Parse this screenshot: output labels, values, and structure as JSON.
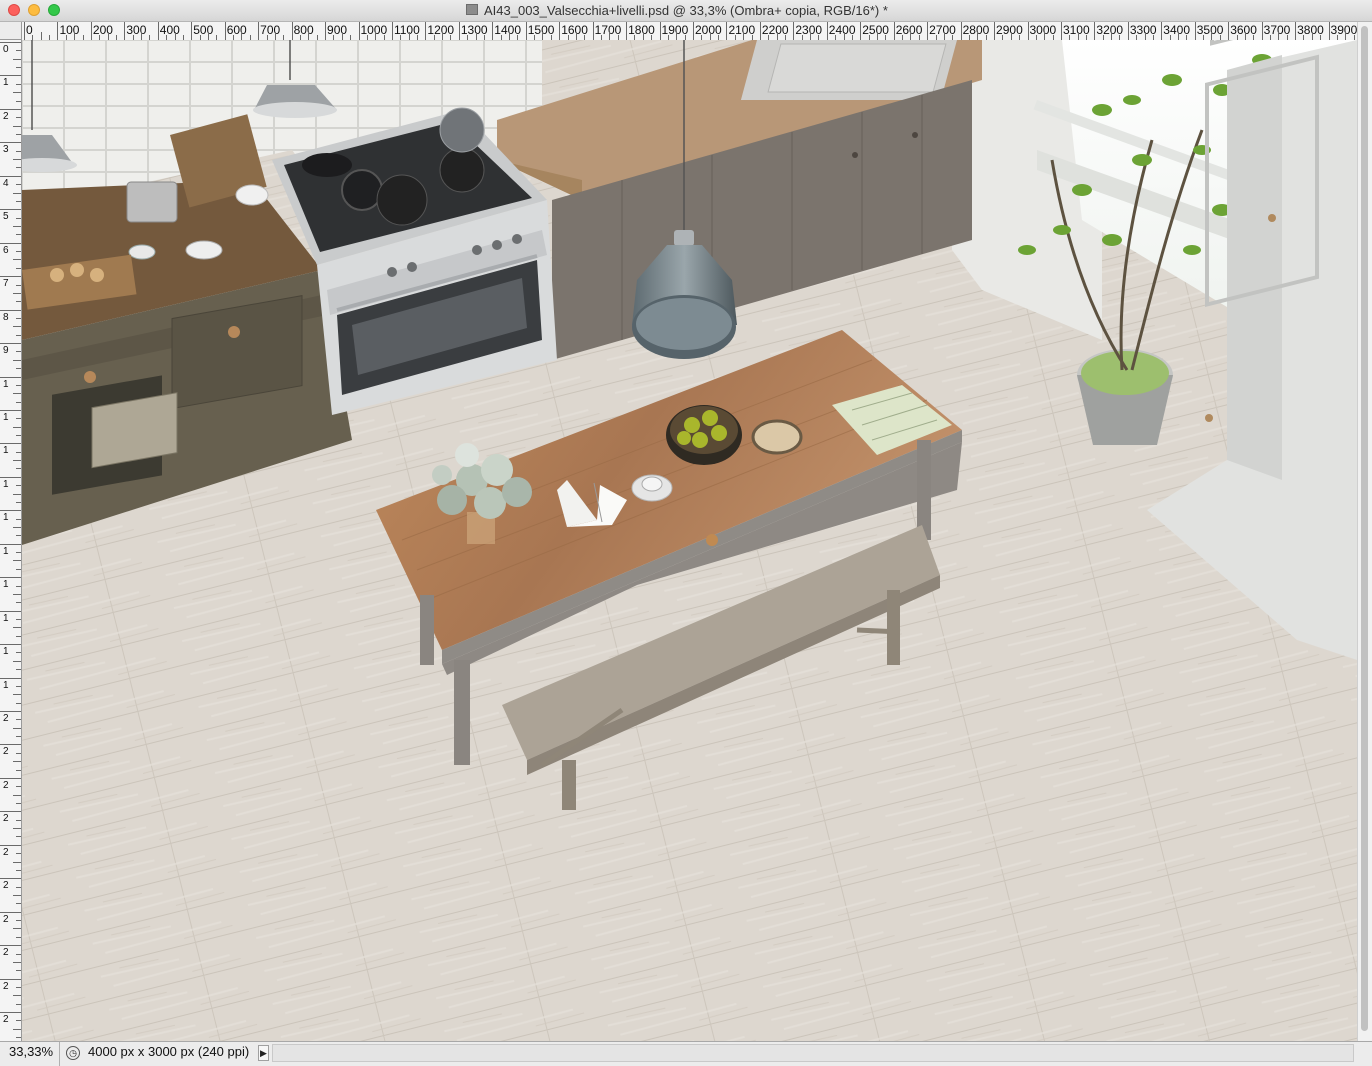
{
  "window": {
    "title": "AI43_003_Valsecchia+livelli.psd @ 33,3% (Ombra+ copia, RGB/16*) *"
  },
  "ruler": {
    "labels": [
      "0",
      "100",
      "200",
      "300",
      "400",
      "500",
      "600",
      "700",
      "800",
      "900",
      "1000",
      "1100",
      "1200",
      "1300",
      "1400",
      "1500",
      "1600",
      "1700",
      "1800",
      "1900",
      "2000",
      "2100",
      "2200",
      "2300",
      "2400",
      "2500",
      "2600",
      "2700",
      "2800",
      "2900",
      "3000",
      "3100",
      "3200",
      "3300",
      "3400",
      "3500",
      "3600",
      "3700",
      "3800",
      "3900"
    ],
    "vertical_labels": [
      "0",
      "1",
      "2",
      "3",
      "4",
      "5",
      "6",
      "7",
      "8",
      "9",
      "1",
      "1",
      "1",
      "1",
      "1",
      "1",
      "1",
      "1",
      "1",
      "1",
      "2",
      "2",
      "2",
      "2",
      "2",
      "2",
      "2",
      "2",
      "2",
      "2"
    ]
  },
  "status": {
    "zoom": "33,33%",
    "doc_info": "4000 px x 3000 px (240 ppi)"
  },
  "colors": {
    "floor": "#dcd6cd",
    "tabletop": "#b07e55",
    "cabinet": "#726b64",
    "counter": "#7a5d40",
    "wall_tile": "#efefed"
  }
}
